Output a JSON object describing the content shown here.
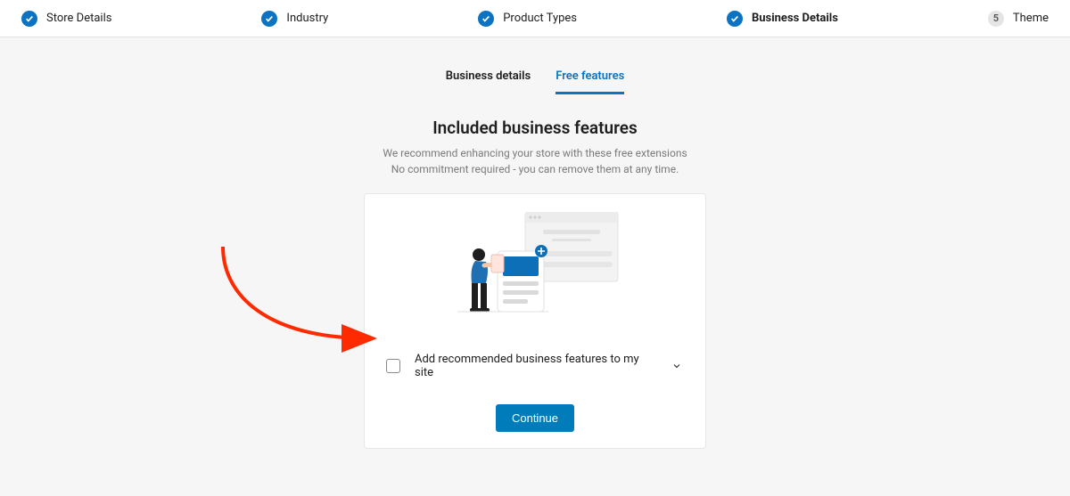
{
  "stepper": {
    "steps": [
      {
        "label": "Store Details",
        "state": "done"
      },
      {
        "label": "Industry",
        "state": "done"
      },
      {
        "label": "Product Types",
        "state": "done"
      },
      {
        "label": "Business Details",
        "state": "done",
        "active": true
      },
      {
        "label": "Theme",
        "state": "pending",
        "num": "5"
      }
    ]
  },
  "tabs": {
    "business": "Business details",
    "features": "Free features"
  },
  "heading": "Included business features",
  "subhead_line1": "We recommend enhancing your store with these free extensions",
  "subhead_line2": "No commitment required - you can remove them at any time.",
  "option": {
    "label": "Add recommended business features to my site"
  },
  "continue_label": "Continue",
  "colors": {
    "accent": "#007cba",
    "stepper_check": "#0c73c2",
    "arrow": "#ff2a00"
  }
}
